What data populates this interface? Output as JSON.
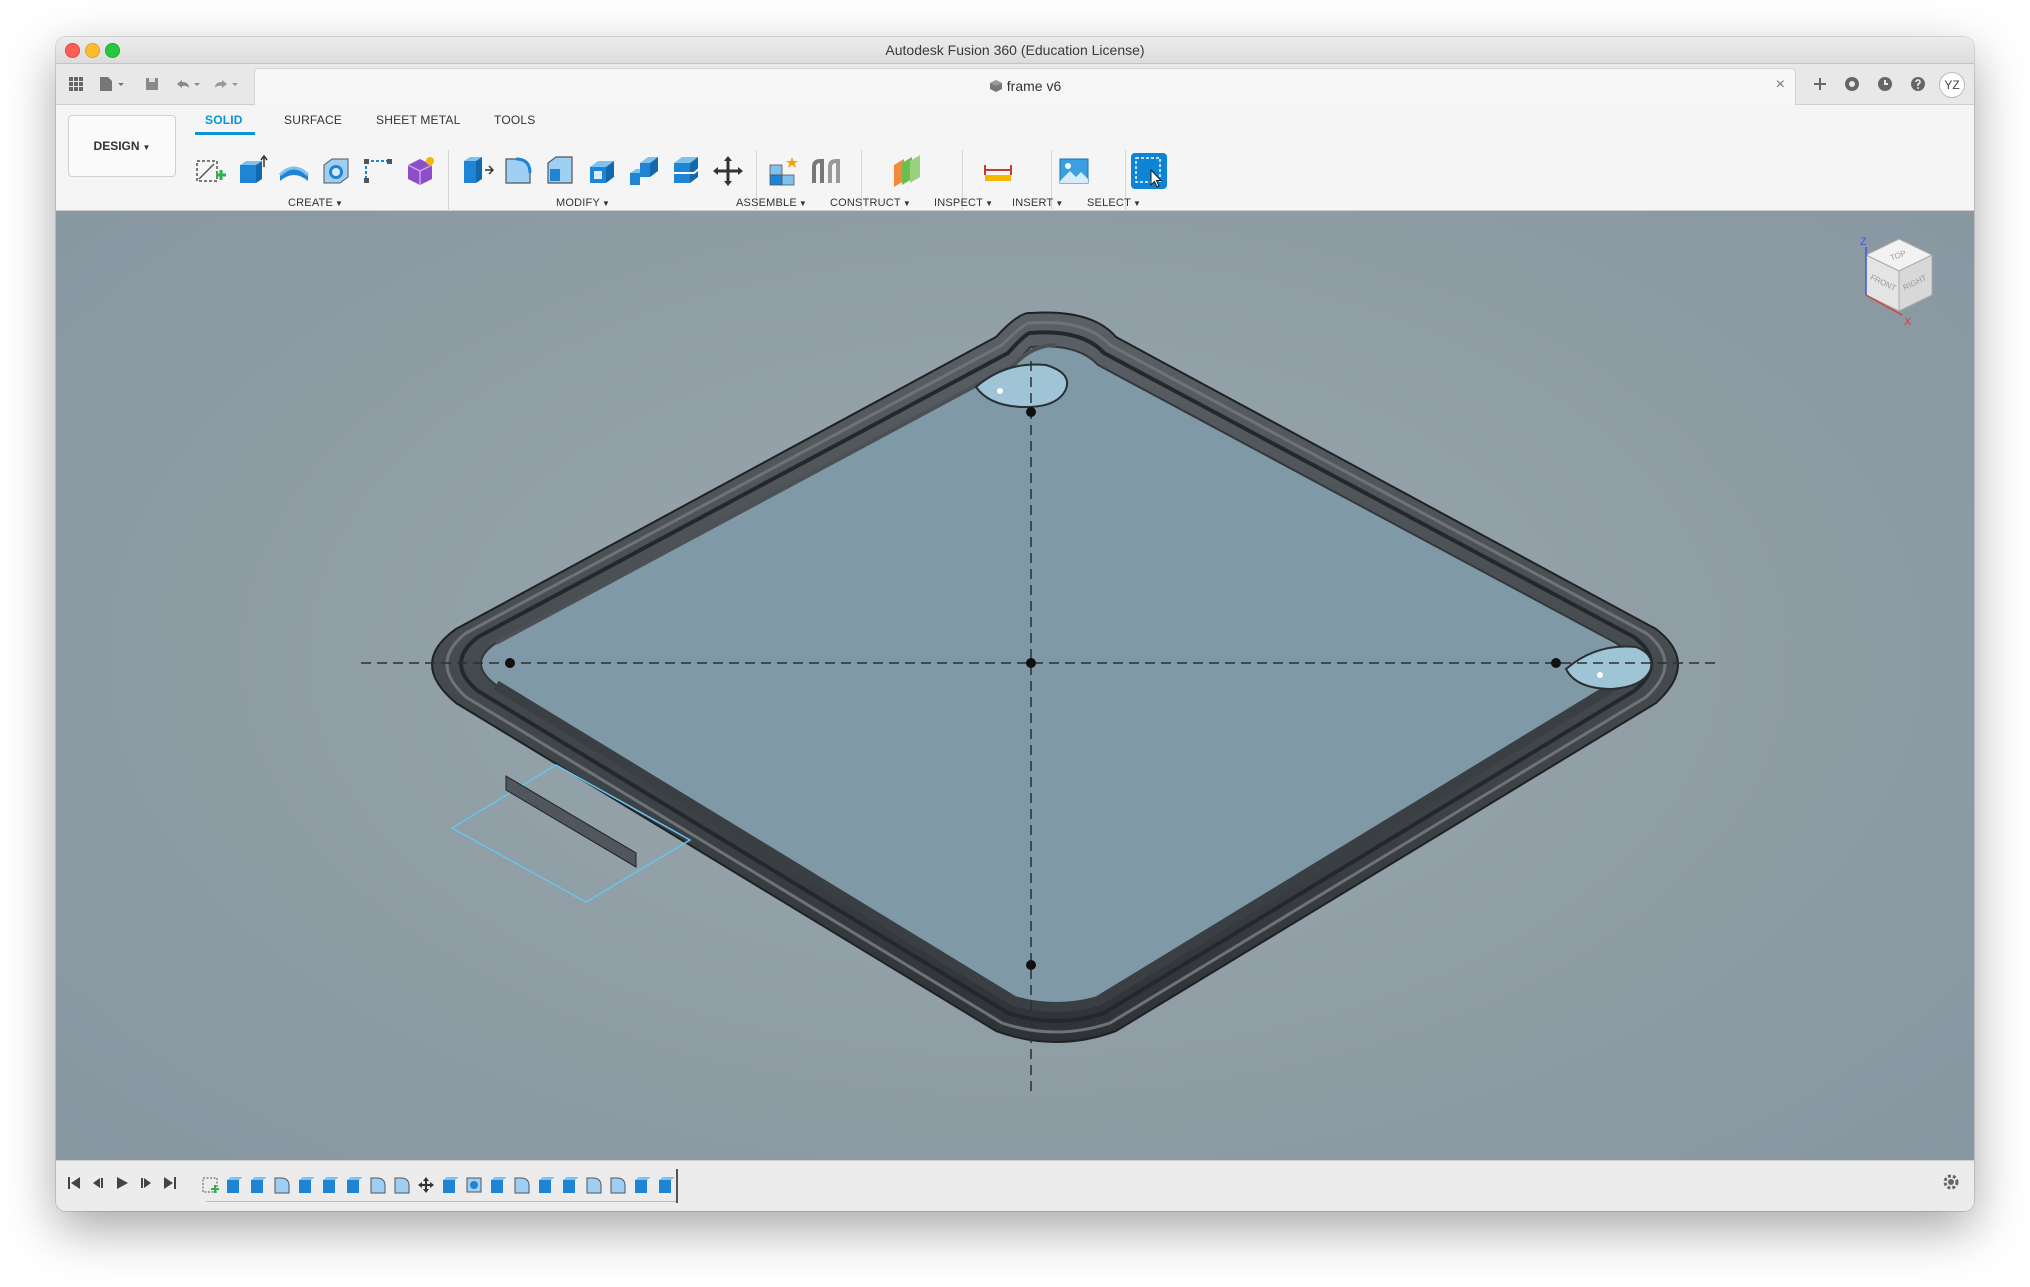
{
  "window": {
    "title": "Autodesk Fusion 360 (Education License)"
  },
  "document": {
    "title": "frame v6",
    "close_icon": "×"
  },
  "quick_access": {
    "grid_icon": "grid-icon",
    "file_icon": "file-icon",
    "save_icon": "save-icon",
    "undo_icon": "undo-icon",
    "redo_icon": "redo-icon",
    "right_buttons": [
      "add-tab-icon",
      "extensions-icon",
      "job-status-icon",
      "help-icon"
    ],
    "avatar": "YZ"
  },
  "ribbon": {
    "workspace": "DESIGN",
    "tabs": [
      "SOLID",
      "SURFACE",
      "SHEET METAL",
      "TOOLS"
    ],
    "active_tab": "SOLID",
    "groups": {
      "create": "CREATE",
      "modify": "MODIFY",
      "assemble": "ASSEMBLE",
      "construct": "CONSTRUCT",
      "inspect": "INSPECT",
      "insert": "INSERT",
      "select": "SELECT"
    }
  },
  "viewcube": {
    "top": "TOP",
    "front": "FRONT",
    "right": "RIGHT",
    "axis_z": "Z",
    "axis_x": "X"
  },
  "colors": {
    "accent": "#0696d7",
    "viewport": "#8e9ca4",
    "frame": "#3d4246",
    "plane_fill": "#7f9aa6"
  },
  "timeline": {
    "controls": [
      "skip-start-icon",
      "step-back-icon",
      "play-icon",
      "step-forward-icon",
      "skip-end-icon"
    ],
    "feature_count": 20
  }
}
